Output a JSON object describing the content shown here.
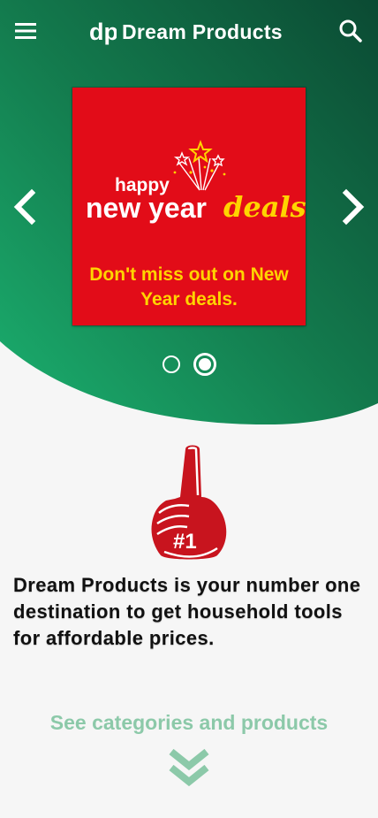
{
  "header": {
    "brand_name": "Dream Products",
    "brand_logo_text": "dp",
    "menu_icon": "hamburger-menu-icon",
    "search_icon": "search-icon"
  },
  "carousel": {
    "prev_icon": "chevron-left-icon",
    "next_icon": "chevron-right-icon",
    "active_slide": 2,
    "slide_count": 2,
    "slide": {
      "banner_line1": "happy",
      "banner_line2": "new year",
      "banner_line3": "deals",
      "caption": "Don't miss out on New Year deals."
    }
  },
  "main": {
    "badge_icon": "number-one-foam-hand-icon",
    "badge_text": "#1",
    "tagline": "Dream Products is your number one destination to get household tools for affordable prices.",
    "cta_label": "See categories and products",
    "cta_icon": "double-chevron-down-icon"
  },
  "colors": {
    "green_dark": "#0d5a3b",
    "green_light": "#1aa56c",
    "banner_red": "#e20c18",
    "banner_yellow": "#ffd400",
    "accent_red": "#c8141e",
    "cta_green": "#8cc9a9"
  }
}
